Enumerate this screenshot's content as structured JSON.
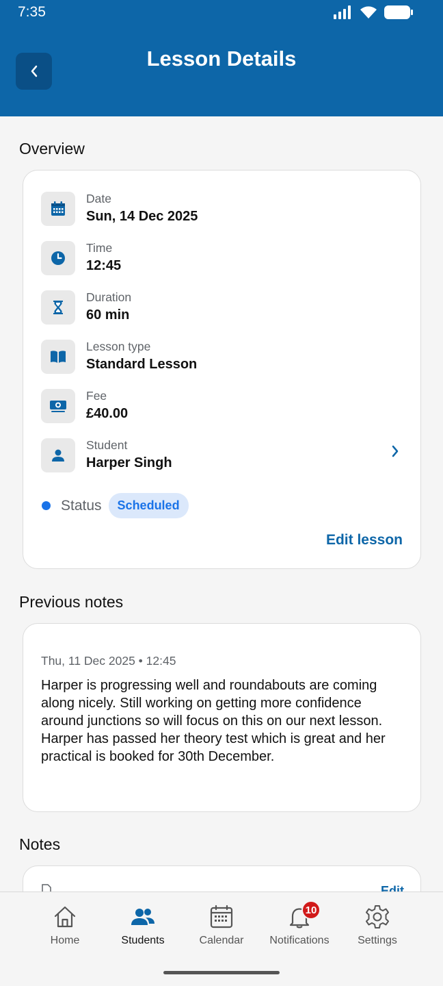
{
  "status_bar": {
    "time": "7:35"
  },
  "header": {
    "title": "Lesson Details"
  },
  "overview": {
    "section_title": "Overview",
    "rows": [
      {
        "label": "Date",
        "value": "Sun, 14 Dec 2025",
        "icon": "calendar-icon"
      },
      {
        "label": "Time",
        "value": "12:45",
        "icon": "clock-icon"
      },
      {
        "label": "Duration",
        "value": "60 min",
        "icon": "hourglass-icon"
      },
      {
        "label": "Lesson type",
        "value": "Standard Lesson",
        "icon": "book-icon"
      },
      {
        "label": "Fee",
        "value": "£40.00",
        "icon": "money-icon"
      },
      {
        "label": "Student",
        "value": "Harper Singh",
        "icon": "person-icon"
      }
    ],
    "status_label": "Status",
    "status_value": "Scheduled",
    "edit_label": "Edit lesson"
  },
  "previous_notes": {
    "section_title": "Previous notes",
    "date": "Thu, 11 Dec 2025 • 12:45",
    "body": "Harper is progressing well and roundabouts are coming along nicely. Still working on getting more confidence around junctions so will focus on this on our next lesson. Harper has passed her theory test which is great and her practical is booked for 30th December."
  },
  "notes": {
    "section_title": "Notes",
    "edit_label": "Edit"
  },
  "bottom_nav": {
    "items": [
      {
        "label": "Home",
        "icon": "home-icon"
      },
      {
        "label": "Students",
        "icon": "students-icon",
        "active": true
      },
      {
        "label": "Calendar",
        "icon": "calendar-icon"
      },
      {
        "label": "Notifications",
        "icon": "bell-icon",
        "badge": "10"
      },
      {
        "label": "Settings",
        "icon": "gear-icon"
      }
    ]
  },
  "colors": {
    "primary": "#0d66a8",
    "accent": "#1a73e8",
    "badge": "#d11a1a"
  }
}
